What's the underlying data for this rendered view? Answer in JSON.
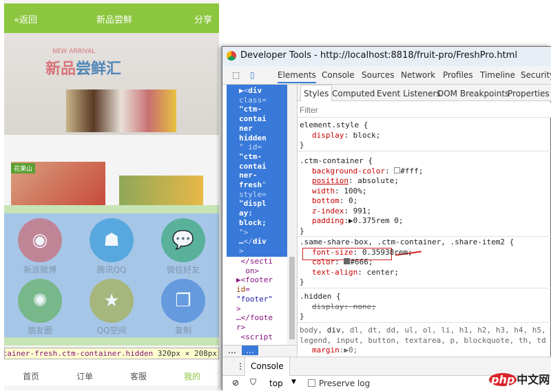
{
  "phone": {
    "back": "«返回",
    "title": "新品尝鲜",
    "share": "分享",
    "banner": {
      "en": "NEW ARRIVAL",
      "cn1": "新品",
      "cn2": "尝鲜汇",
      "brand": "花果山"
    },
    "share_items": [
      {
        "label": "新浪微博",
        "icon": "weibo-icon",
        "color": "#c47a8a"
      },
      {
        "label": "腾讯QQ",
        "icon": "qq-icon",
        "color": "#4aa3dd"
      },
      {
        "label": "微信好友",
        "icon": "wechat-icon",
        "color": "#4cae8c"
      },
      {
        "label": "朋友圈",
        "icon": "moments-icon",
        "color": "#6fb57a"
      },
      {
        "label": "QQ空间",
        "icon": "qzone-icon",
        "color": "#a6b46a"
      },
      {
        "label": "复制",
        "icon": "copy-icon",
        "color": "#5a93dd"
      }
    ],
    "tooltip": {
      "selector": "ntainer-fresh.ctm-container.hidden",
      "size": "320px × 208px"
    },
    "tabs": [
      "首页",
      "订单",
      "客服",
      "我的"
    ]
  },
  "devtools": {
    "title": "Developer Tools - http://localhost:8818/fruit-pro/FreshPro.html",
    "panels": [
      "Elements",
      "Console",
      "Sources",
      "Network",
      "Profiles",
      "Timeline",
      "Security"
    ],
    "subtabs": [
      "Styles",
      "Computed",
      "Event Listeners",
      "DOM Breakpoints",
      "Properties"
    ],
    "filter_placeholder": "Filter",
    "console_label": "Console",
    "context": "top",
    "preserve_log": "Preserve log"
  },
  "watermark": "php中文网"
}
